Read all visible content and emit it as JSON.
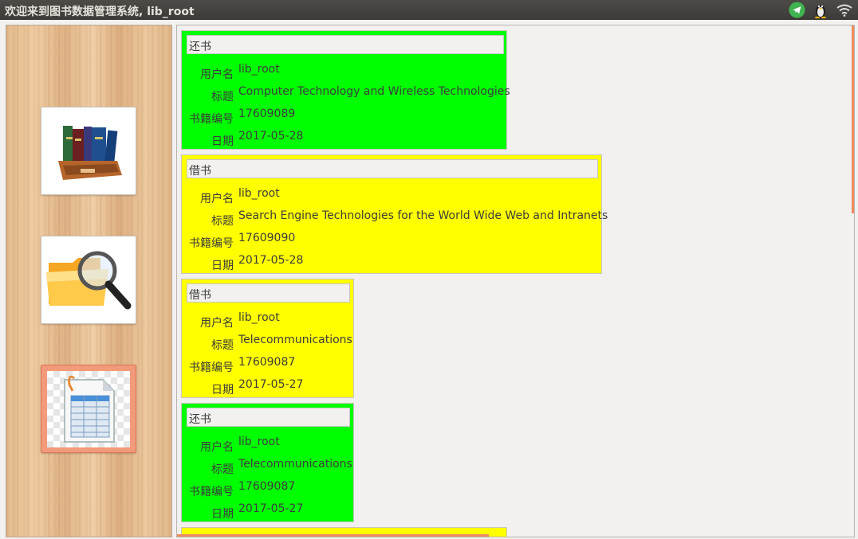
{
  "window": {
    "title": "欢迎来到图书数据管理系统, lib_root",
    "tray_icons": [
      "telegram-icon",
      "linux-penguin-icon",
      "wifi-icon"
    ]
  },
  "sidebar": {
    "items": [
      {
        "name": "books",
        "icon": "books-icon"
      },
      {
        "name": "search",
        "icon": "folder-search-icon"
      },
      {
        "name": "records",
        "icon": "spreadsheet-icon",
        "active": true
      }
    ]
  },
  "labels": {
    "user": "用户名",
    "title": "标题",
    "book_id": "书籍编号",
    "date": "日期"
  },
  "records": [
    {
      "type": "还书",
      "color": "#00ff00",
      "user": "lib_root",
      "title": "Computer Technology and Wireless Technologies",
      "book_id": "17609089",
      "date": "2017-05-28"
    },
    {
      "type": "借书",
      "color": "#ffff00",
      "user": "lib_root",
      "title": "Search Engine Technologies for the World Wide Web and Intranets",
      "book_id": "17609090",
      "date": "2017-05-28"
    },
    {
      "type": "借书",
      "color": "#ffff00",
      "user": "lib_root",
      "title": "Telecommunications",
      "book_id": "17609087",
      "date": "2017-05-27"
    },
    {
      "type": "还书",
      "color": "#00ff00",
      "user": "lib_root",
      "title": "Telecommunications",
      "book_id": "17609087",
      "date": "2017-05-27"
    }
  ],
  "colors": {
    "return": "#00ff00",
    "borrow": "#ffff00",
    "accent": "#f08a5d"
  }
}
